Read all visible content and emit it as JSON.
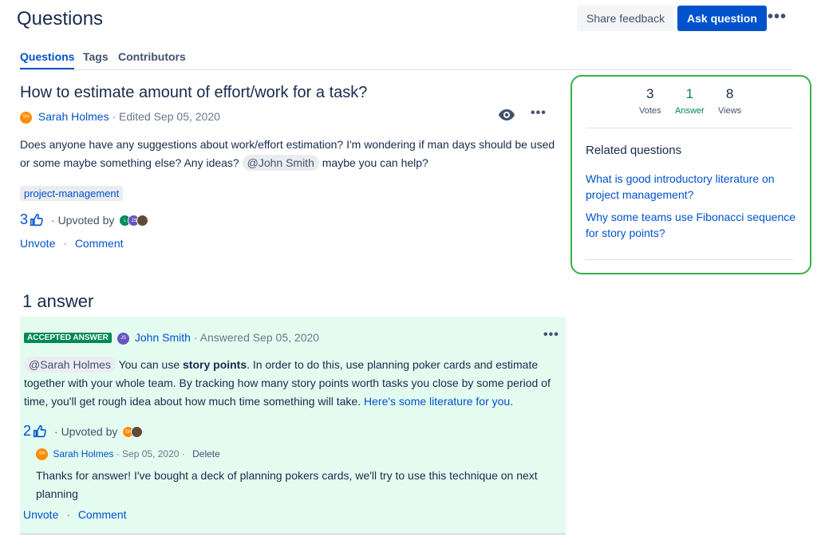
{
  "header": {
    "title": "Questions",
    "share_feedback": "Share feedback",
    "ask_question": "Ask question",
    "more": "•••"
  },
  "tabs": [
    {
      "label": "Questions",
      "active": true
    },
    {
      "label": "Tags",
      "active": false
    },
    {
      "label": "Contributors",
      "active": false
    }
  ],
  "question": {
    "title": "How to estimate amount of effort/work for a task?",
    "author_initials": "SH",
    "author": "Sarah Holmes",
    "edited": "· Edited Sep 05, 2020",
    "body_part1": "Does anyone have any suggestions about work/effort estimation? I'm wondering if man days should be used or some maybe something else? Any ideas?",
    "mention": "@John Smith",
    "body_part2": "maybe you can help?",
    "tag": "project-management",
    "votes": "3",
    "upvoted_by": "· Upvoted by",
    "upvoter_initials": [
      "L",
      "JS",
      ""
    ],
    "unvote": "Unvote",
    "dot": "·",
    "comment": "Comment",
    "more": "•••",
    "icons": [
      "eye-icon",
      "thumbs-up-icon"
    ]
  },
  "answers": {
    "title": "1 answer",
    "items": [
      {
        "accepted_label": "ACCEPTED ANSWER",
        "author_initials": "JS",
        "author": "John Smith",
        "answered": "· Answered Sep 05, 2020",
        "mention": "@Sarah Holmes",
        "body_part1": "You can use",
        "bold": "story points",
        "body_part2": ". In order to do this, use planning poker cards and estimate together with your whole team. By tracking how many story points worth tasks you close by some period of time, you'll get rough idea about how much time something will take.",
        "link": "Here's some literature for you",
        "body_end": ".",
        "votes": "2",
        "upvoted_by": "· Upvoted by",
        "upvoter_initials": [
          "SH",
          ""
        ],
        "more": "•••",
        "comment": {
          "author_initials": "SH",
          "author": "Sarah Holmes",
          "date": "· Sep 05, 2020 ·",
          "delete": "Delete",
          "body": "Thanks for answer! I've bought a deck of planning pokers cards, we'll try to use this technique on next planning"
        },
        "unvote": "Unvote",
        "dot": "·",
        "comment_link": "Comment"
      }
    ]
  },
  "sidebar": {
    "stats": [
      {
        "num": "3",
        "label": "Votes",
        "color": "#172b4d"
      },
      {
        "num": "1",
        "label": "Answer",
        "color": "#00875a"
      },
      {
        "num": "8",
        "label": "Views",
        "color": "#172b4d"
      }
    ],
    "related_title": "Related questions",
    "related": [
      "What is good introductory literature on project management?",
      "Why some teams use Fibonacci sequence for story points?"
    ]
  },
  "colors": {
    "primary": "#0052cc",
    "accepted": "#00875a",
    "answer_bg": "#e3fcef",
    "highlight_border": "#36b24a"
  }
}
